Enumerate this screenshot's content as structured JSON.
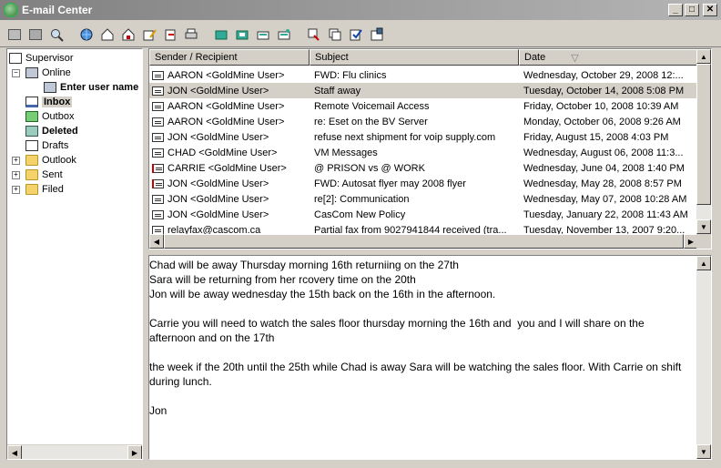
{
  "window": {
    "title": "E-mail Center"
  },
  "toolbar": {
    "icons": [
      "open-icon",
      "close-folder-icon",
      "search-icon",
      "globe-icon",
      "home-icon",
      "home-alert-icon",
      "compose-icon",
      "reply-icon",
      "print-icon",
      "folder-icon",
      "folder-icon",
      "folder-icon",
      "folder-icon",
      "filter-icon",
      "copy-icon",
      "check-icon",
      "properties-icon"
    ]
  },
  "folders": {
    "root": "Supervisor",
    "online": "Online",
    "enter_user": "Enter user name",
    "inbox": "Inbox",
    "outbox": "Outbox",
    "deleted": "Deleted",
    "drafts": "Drafts",
    "outlook": "Outlook",
    "sent": "Sent",
    "filed": "Filed"
  },
  "list": {
    "columns": [
      "Sender / Recipient",
      "Subject",
      "Date"
    ],
    "rows": [
      {
        "sender": "AARON <GoldMine User>",
        "subject": "FWD: Flu clinics",
        "date": "Wednesday, October 29, 2008  12:..."
      },
      {
        "sender": "JON <GoldMine User>",
        "subject": "Staff away",
        "date": "Tuesday, October 14, 2008  5:08 PM",
        "selected": true
      },
      {
        "sender": "AARON <GoldMine User>",
        "subject": "Remote Voicemail Access",
        "date": "Friday, October 10, 2008  10:39 AM"
      },
      {
        "sender": "AARON <GoldMine User>",
        "subject": "re: Eset on the BV Server",
        "date": "Monday, October 06, 2008  9:26 AM"
      },
      {
        "sender": "JON <GoldMine User>",
        "subject": "refuse next shipment for voip supply.com",
        "date": "Friday, August 15, 2008  4:03 PM"
      },
      {
        "sender": "CHAD <GoldMine User>",
        "subject": "VM Messages",
        "date": "Wednesday, August 06, 2008  11:3..."
      },
      {
        "sender": "CARRIE <GoldMine User>",
        "subject": "@ PRISON vs @ WORK",
        "date": "Wednesday, June 04, 2008  1:40 PM",
        "flag": true
      },
      {
        "sender": "JON <GoldMine User>",
        "subject": "FWD: Autosat flyer may 2008 flyer",
        "date": "Wednesday, May 28, 2008  8:57 PM",
        "flag": true
      },
      {
        "sender": "JON <GoldMine User>",
        "subject": "re[2]: Communication",
        "date": "Wednesday, May 07, 2008  10:28 AM"
      },
      {
        "sender": "JON <GoldMine User>",
        "subject": "CasCom New Policy",
        "date": "Tuesday, January 22, 2008  11:43 AM"
      },
      {
        "sender": "relayfax@cascom.ca",
        "subject": "Partial fax from 9027941844 received (tra...",
        "date": "Tuesday, November 13, 2007  9:20..."
      }
    ]
  },
  "preview": {
    "body": "Chad will be away Thursday morning 16th returniing on the 27th\nSara will be returning from her rcovery time on the 20th\nJon will be away wednesday the 15th back on the 16th in the afternoon.\n\nCarrie you will need to watch the sales floor thursday morning the 16th and  you and I will share on the afternoon and on the 17th\n\nthe week if the 20th until the 25th while Chad is away Sara will be watching the sales floor. With Carrie on shift during lunch.\n\nJon"
  }
}
